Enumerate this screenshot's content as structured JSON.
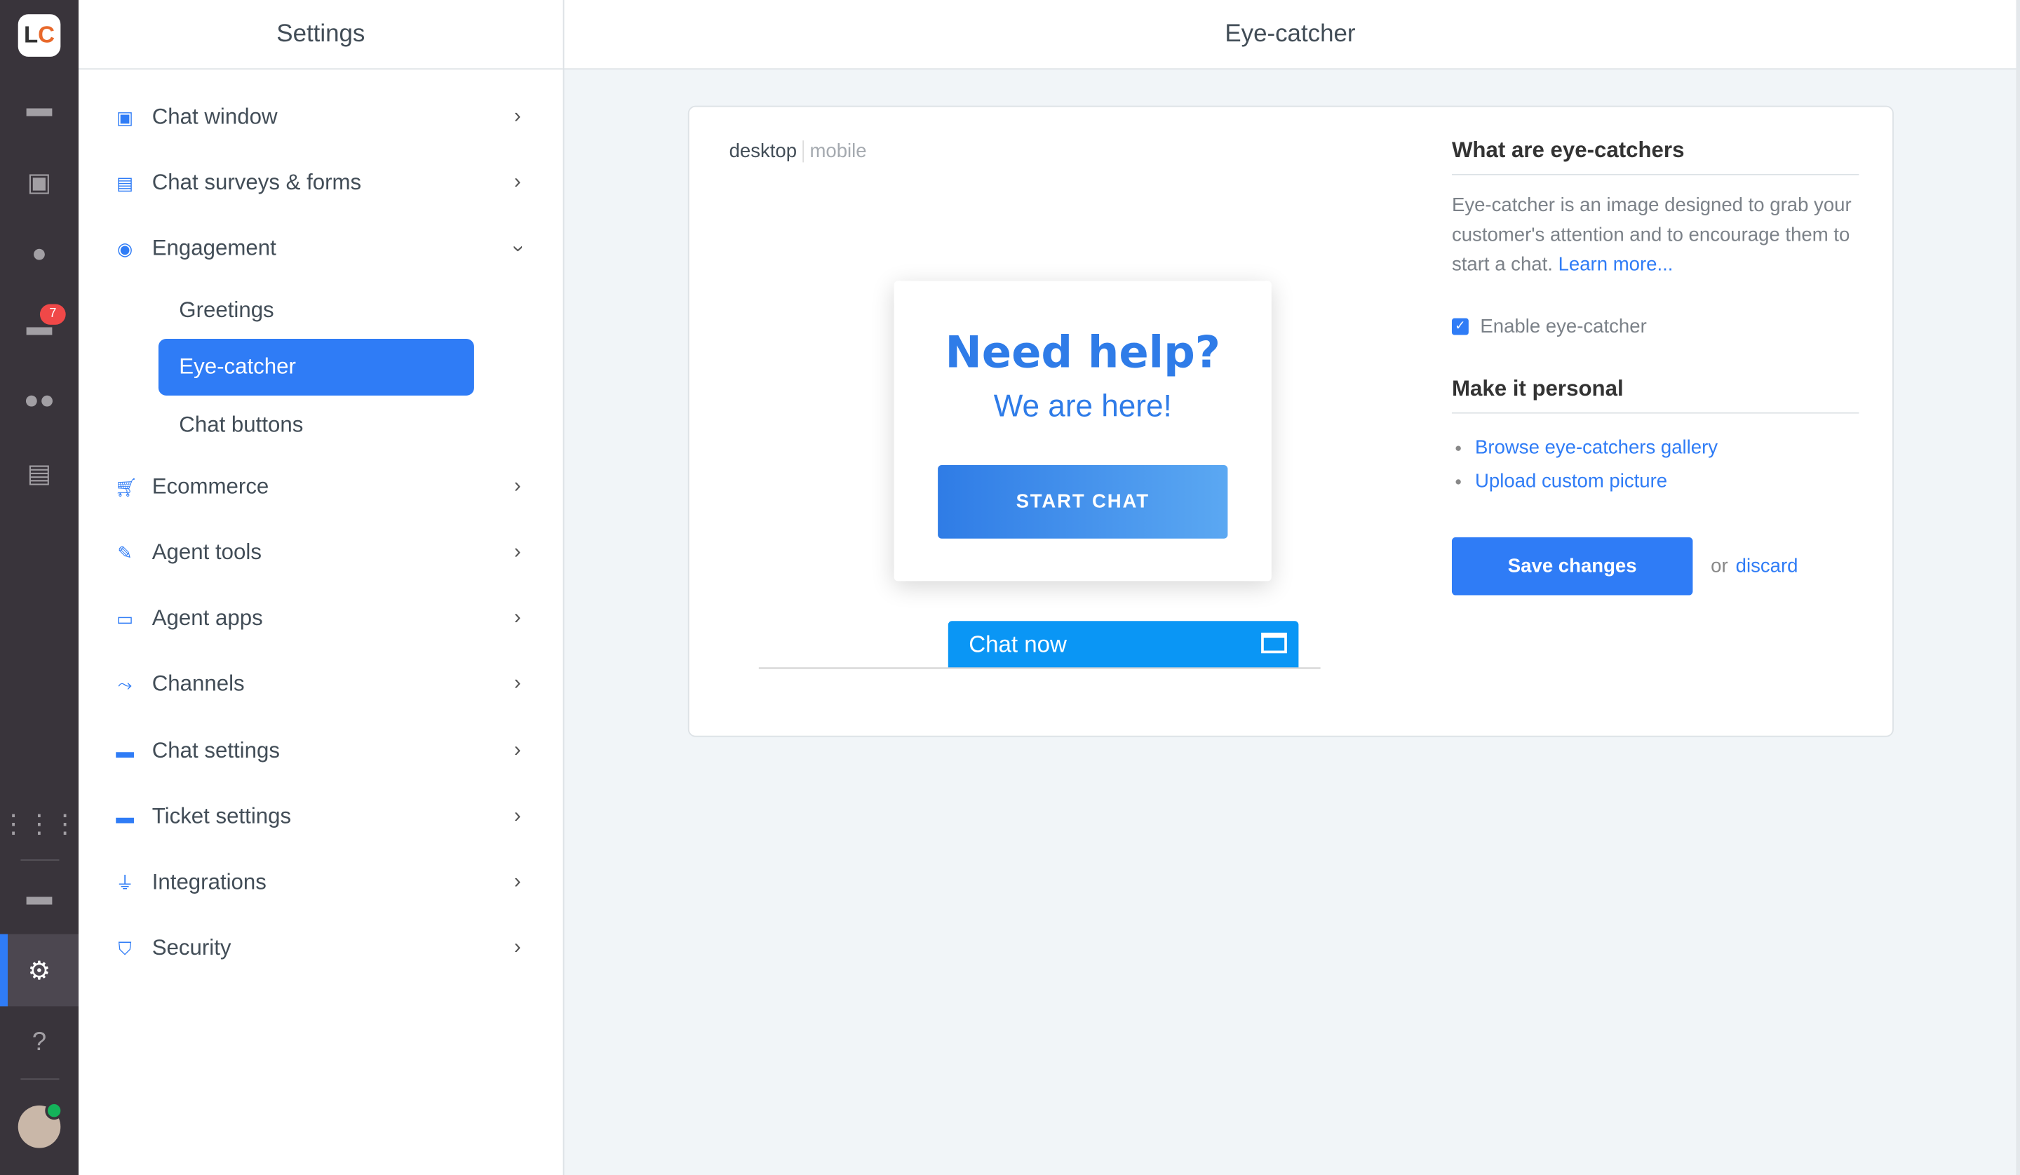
{
  "rail": {
    "logo": "LC",
    "badge": "7",
    "items": [
      "chats",
      "customers",
      "archives",
      "tickets",
      "agents",
      "reports",
      "apps",
      "billing",
      "settings",
      "help"
    ]
  },
  "sidebar": {
    "title": "Settings",
    "items": [
      {
        "label": "Chat window",
        "icon": "window-icon"
      },
      {
        "label": "Chat surveys & forms",
        "icon": "clipboard-icon"
      },
      {
        "label": "Engagement",
        "icon": "eye-icon",
        "expanded": true,
        "children": [
          "Greetings",
          "Eye-catcher",
          "Chat buttons"
        ],
        "selected": "Eye-catcher"
      },
      {
        "label": "Ecommerce",
        "icon": "cart-icon"
      },
      {
        "label": "Agent tools",
        "icon": "wrench-icon"
      },
      {
        "label": "Agent apps",
        "icon": "apps-icon"
      },
      {
        "label": "Channels",
        "icon": "channels-icon"
      },
      {
        "label": "Chat settings",
        "icon": "chat-icon"
      },
      {
        "label": "Ticket settings",
        "icon": "ticket-icon"
      },
      {
        "label": "Integrations",
        "icon": "plug-icon"
      },
      {
        "label": "Security",
        "icon": "shield-icon"
      }
    ]
  },
  "main": {
    "title": "Eye-catcher",
    "preview": {
      "tab_desktop": "desktop",
      "tab_mobile": "mobile",
      "headline": "Need help?",
      "subline": "We are here!",
      "button": "START CHAT",
      "chat_bar": "Chat now"
    },
    "info": {
      "heading": "What are eye-catchers",
      "text": "Eye-catcher is an image designed to grab your customer's attention and to encourage them to start a chat.",
      "learn_more": "Learn more...",
      "enable_label": "Enable eye-catcher",
      "enabled": true,
      "personal_heading": "Make it personal",
      "links": [
        "Browse eye-catchers gallery",
        "Upload custom picture"
      ],
      "save": "Save changes",
      "or": "or",
      "discard": "discard"
    }
  },
  "colors": {
    "accent": "#2f7cf6",
    "rail": "#39343b",
    "chat_bar": "#0a96f5"
  }
}
